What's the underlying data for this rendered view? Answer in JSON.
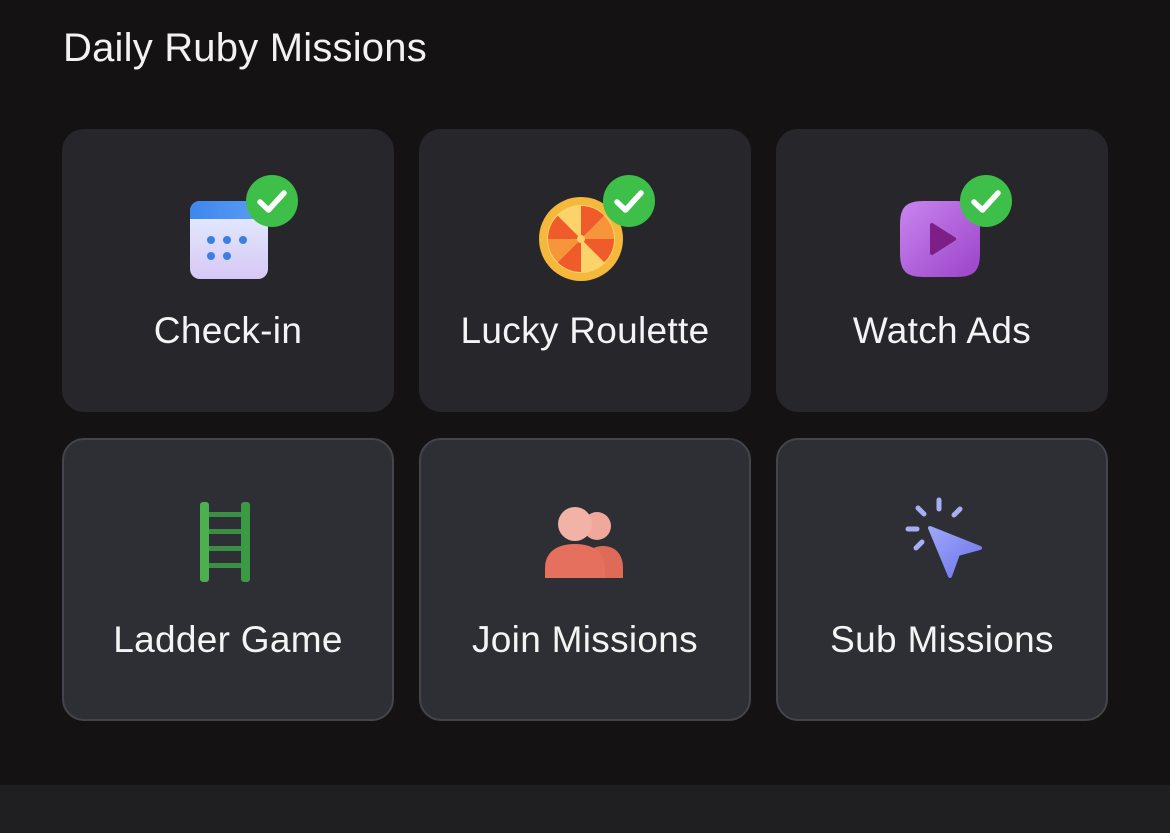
{
  "section": {
    "title": "Daily Ruby Missions"
  },
  "missions": [
    {
      "label": "Check-in",
      "icon": "calendar-icon",
      "completed": true
    },
    {
      "label": "Lucky Roulette",
      "icon": "roulette-icon",
      "completed": true
    },
    {
      "label": "Watch Ads",
      "icon": "play-video-icon",
      "completed": true
    },
    {
      "label": "Ladder Game",
      "icon": "ladder-icon",
      "completed": false
    },
    {
      "label": "Join Missions",
      "icon": "users-icon",
      "completed": false
    },
    {
      "label": "Sub Missions",
      "icon": "cursor-click-icon",
      "completed": false
    }
  ],
  "colors": {
    "background": "#141213",
    "card_completed": "#27272b",
    "card_pending": "#2e2f34",
    "check_green": "#3dbf4a",
    "ladder_green": "#3f9c47",
    "users_red": "#e4705f",
    "cursor_blue": "#7b84f0",
    "video_purple": "#b25ad8"
  }
}
